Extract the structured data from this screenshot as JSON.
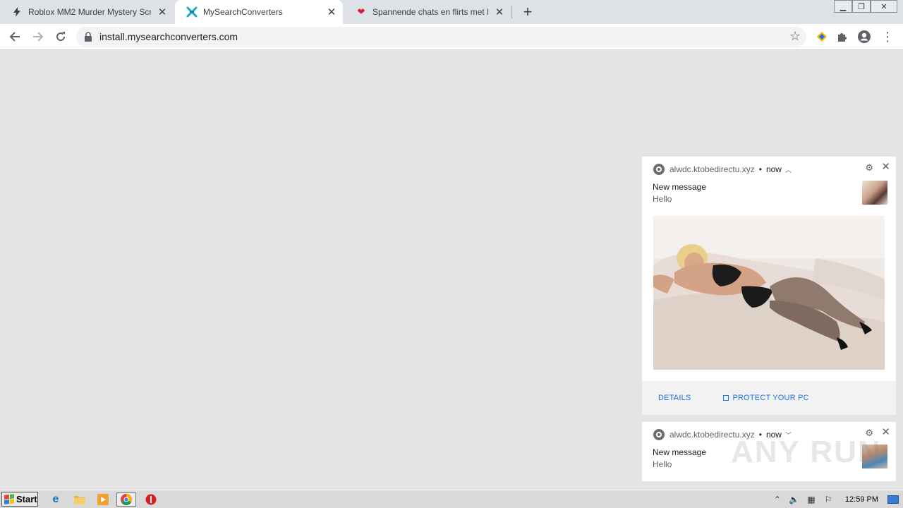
{
  "tabs": [
    {
      "title": "Roblox MM2 Murder Mystery Script G",
      "icon": "lightning-icon",
      "active": false
    },
    {
      "title": "MySearchConverters",
      "icon": "mysearchconverters-icon",
      "active": true
    },
    {
      "title": "Spannende chats en flirts met hete c",
      "icon": "heart-icon",
      "active": false
    }
  ],
  "address_bar": {
    "url": "install.mysearchconverters.com"
  },
  "notifications": [
    {
      "source": "alwdc.ktobedirectu.xyz",
      "dot": "•",
      "time": "now",
      "title": "New message",
      "body": "Hello",
      "actions": {
        "details": "DETAILS",
        "protect": "PROTECT YOUR PC"
      }
    },
    {
      "source": "alwdc.ktobedirectu.xyz",
      "dot": "•",
      "time": "now",
      "title": "New message",
      "body": "Hello"
    }
  ],
  "watermark": "ANY RUN",
  "taskbar": {
    "start_label": "Start",
    "clock": "12:59 PM"
  },
  "colors": {
    "accent": "#1a73e8",
    "tabstrip": "#dee1e6",
    "page_bg": "#e4e4e4"
  }
}
